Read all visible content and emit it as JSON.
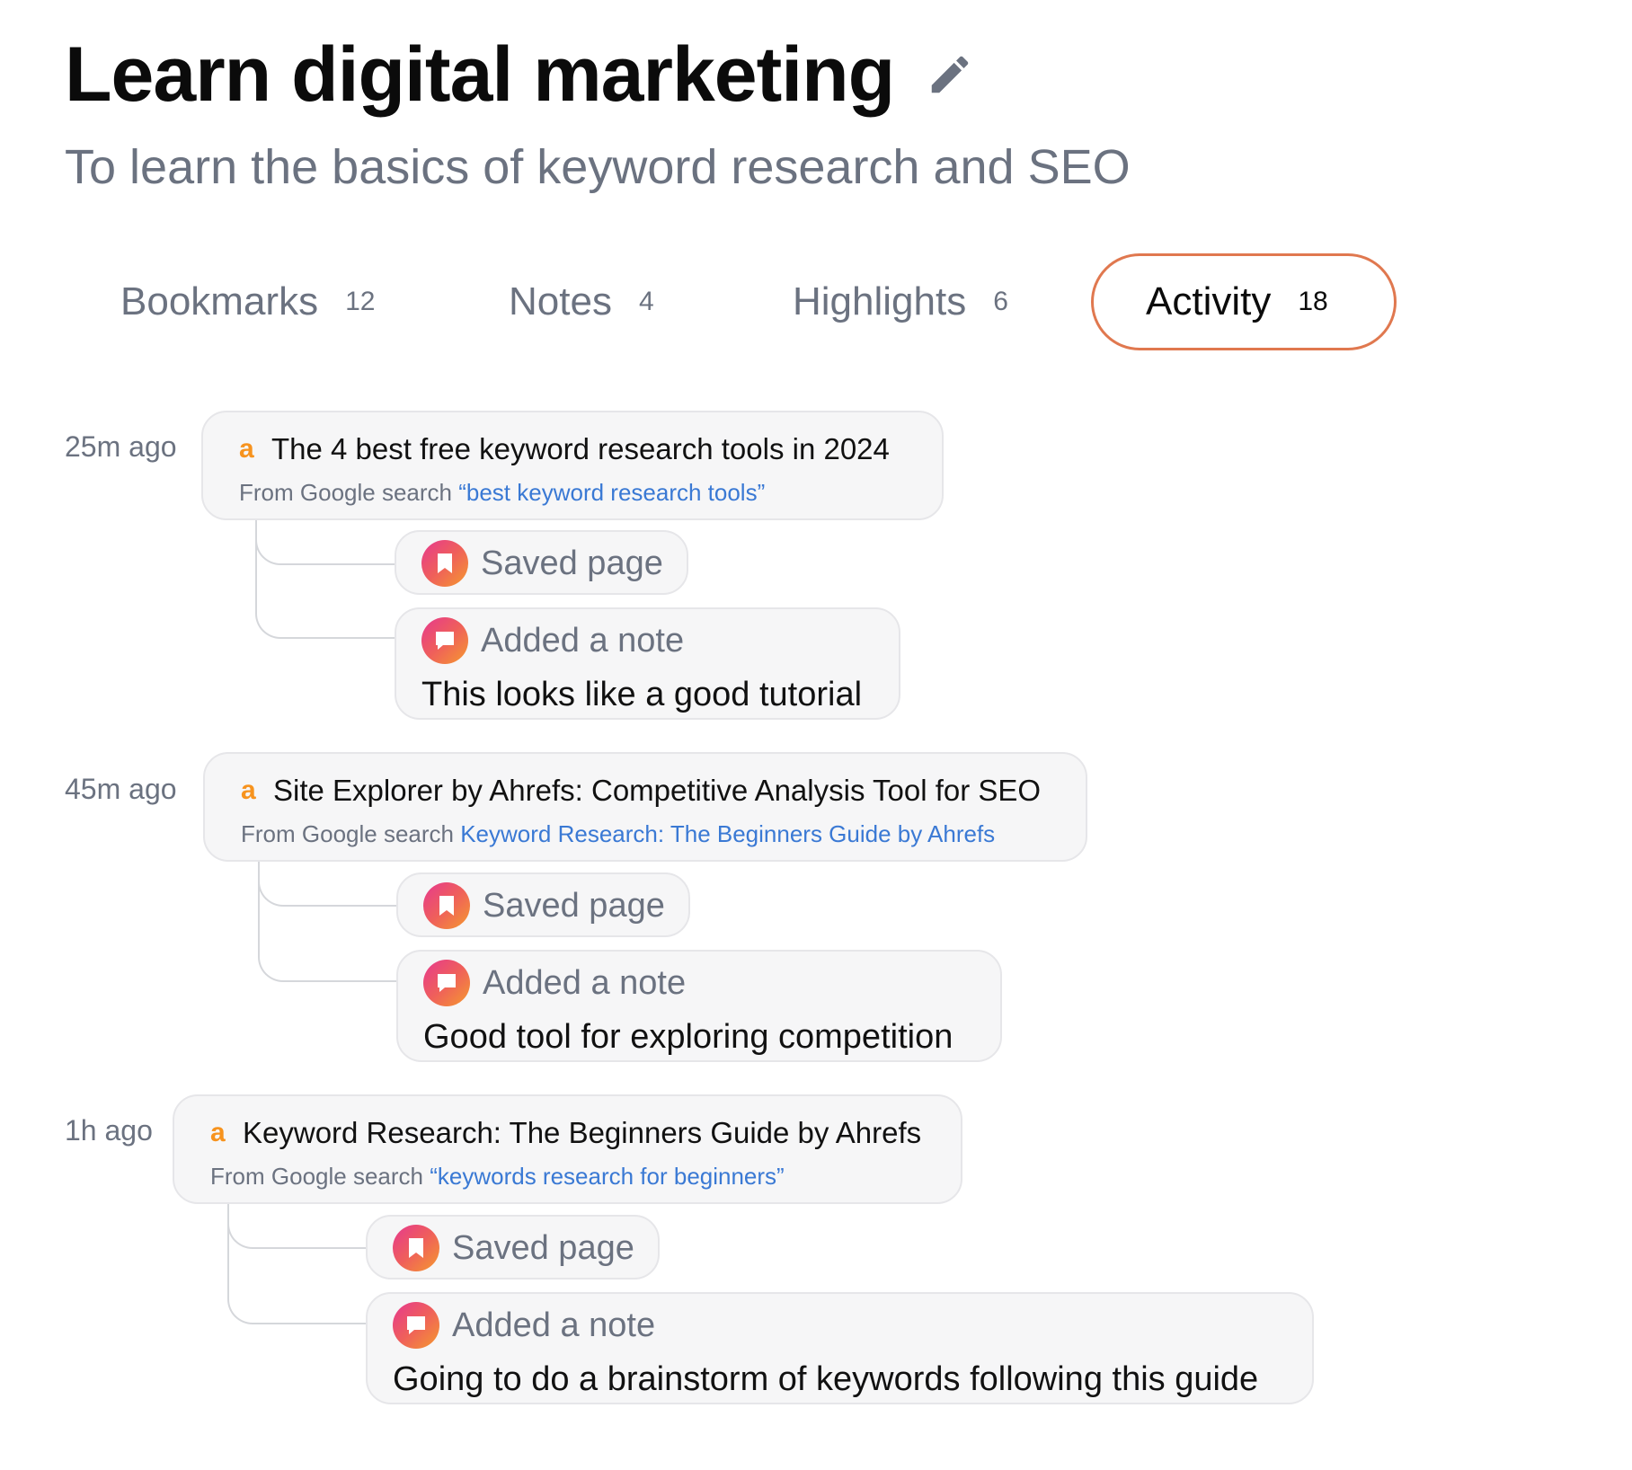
{
  "header": {
    "title": "Learn digital marketing",
    "subtitle": "To learn the basics of keyword research and SEO",
    "edit_icon": "pencil-icon"
  },
  "tabs": [
    {
      "label": "Bookmarks",
      "count": "12",
      "active": false
    },
    {
      "label": "Notes",
      "count": "4",
      "active": false
    },
    {
      "label": "Highlights",
      "count": "6",
      "active": false
    },
    {
      "label": "Activity",
      "count": "18",
      "active": true
    }
  ],
  "colors": {
    "accent_border": "#e0784f",
    "link_blue": "#3a79d4",
    "ahrefs_orange": "#f7931e",
    "icon_gradient": [
      "#e6388f",
      "#ef5f5b",
      "#f59a2e"
    ]
  },
  "activity": [
    {
      "time": "25m ago",
      "page_title": "The 4 best free keyword research tools in 2024",
      "source_prefix": "From Google search ",
      "source_query": "“best keyword research tools”",
      "saved_label": "Saved page",
      "note_label": "Added a note",
      "note_text": "This looks like a good tutorial"
    },
    {
      "time": "45m ago",
      "page_title": "Site Explorer by Ahrefs: Competitive Analysis Tool for SEO",
      "source_prefix": "From Google search ",
      "source_query": "Keyword Research: The Beginners Guide by Ahrefs",
      "saved_label": "Saved page",
      "note_label": "Added a note",
      "note_text": "Good tool for exploring competition"
    },
    {
      "time": "1h ago",
      "page_title": "Keyword Research: The Beginners Guide by Ahrefs",
      "source_prefix": "From Google search ",
      "source_query": "“keywords research for beginners”",
      "saved_label": "Saved page",
      "note_label": "Added a note",
      "note_text": "Going to do a brainstorm of keywords following this guide"
    }
  ],
  "icons": {
    "site": "ahrefs-logo-icon",
    "saved": "bookmark-icon",
    "note": "note-bubble-icon"
  }
}
